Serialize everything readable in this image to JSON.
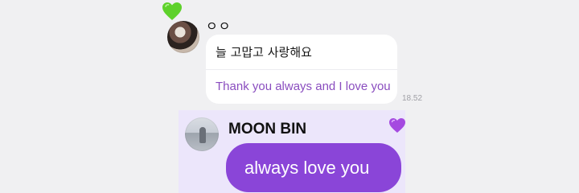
{
  "top_reaction": {
    "icon": "green-heart-icon",
    "color": "#5ed12b"
  },
  "message_1": {
    "sender": "ㅇㅇ",
    "text_korean": "늘 고맙고 사랑해요",
    "text_translation": "Thank you always and I love you",
    "time": "18.52",
    "translation_color": "#8a4dbf"
  },
  "message_2": {
    "sender": "MOON BIN",
    "text": "always love you",
    "reaction": {
      "icon": "purple-heart-icon",
      "color": "#a54ae0"
    },
    "bubble_color": "#8a45d8",
    "highlight_color": "#ece6fb"
  }
}
